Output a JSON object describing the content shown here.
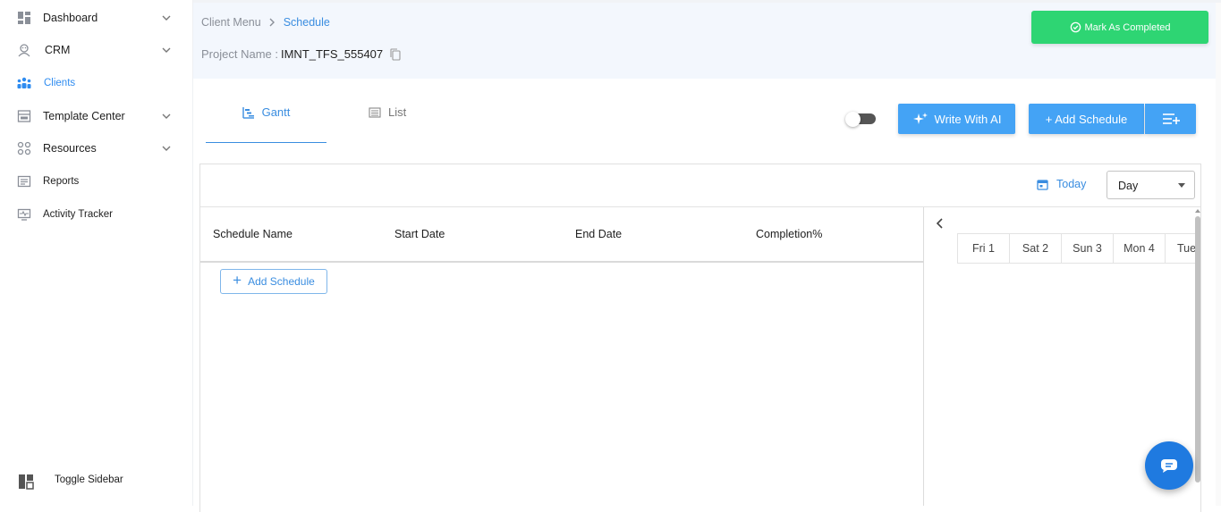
{
  "sidebar": {
    "items": [
      {
        "label": "Dashboard",
        "icon": "dashboard-icon",
        "has_chevron": true
      },
      {
        "label": "CRM",
        "icon": "crm-icon",
        "has_chevron": true
      },
      {
        "label": "Clients",
        "icon": "clients-icon",
        "has_chevron": false,
        "active": true
      },
      {
        "label": "Template Center",
        "icon": "template-icon",
        "has_chevron": true
      },
      {
        "label": "Resources",
        "icon": "resources-icon",
        "has_chevron": true
      },
      {
        "label": "Reports",
        "icon": "reports-icon",
        "has_chevron": false
      },
      {
        "label": "Activity Tracker",
        "icon": "activity-icon",
        "has_chevron": false
      }
    ],
    "toggle_label": "Toggle Sidebar"
  },
  "header": {
    "breadcrumb": {
      "parent": "Client Menu",
      "current": "Schedule"
    },
    "project_label": "Project Name :",
    "project_value": "IMNT_TFS_555407",
    "mark_completed": "Mark As Completed"
  },
  "tabs": [
    {
      "label": "Gantt",
      "active": true
    },
    {
      "label": "List",
      "active": false
    }
  ],
  "toolbar": {
    "write_ai": "Write With AI",
    "add_schedule": "+ Add Schedule"
  },
  "gantt": {
    "today_label": "Today",
    "view_select": "Day",
    "columns": [
      "Schedule Name",
      "Start Date",
      "End Date",
      "Completion%"
    ],
    "add_schedule": "Add Schedule",
    "days": [
      "Fri 1",
      "Sat 2",
      "Sun 3",
      "Mon 4",
      "Tue"
    ]
  },
  "colors": {
    "accent": "#3a8de0",
    "primary_button": "#44a3f5",
    "success": "#2ed573",
    "header_bg": "#f3f7fd",
    "chat": "#1f7ae0"
  }
}
